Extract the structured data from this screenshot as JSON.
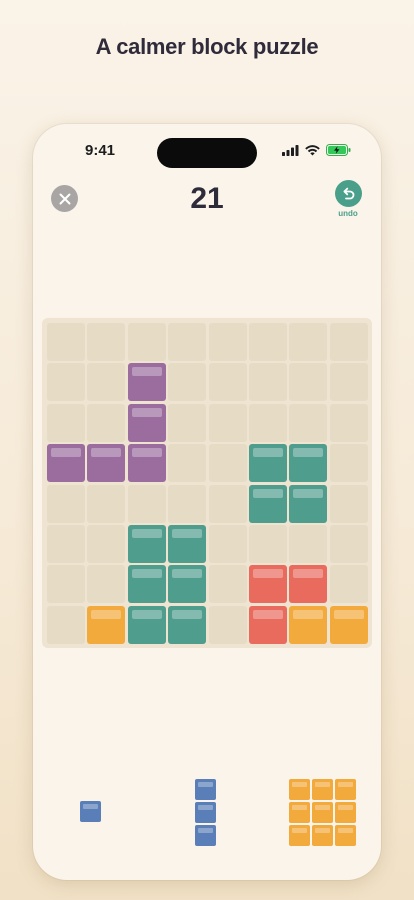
{
  "headline": "A calmer block puzzle",
  "status_bar": {
    "time": "9:41",
    "icons": [
      "signal-icon",
      "wifi-icon",
      "battery-charging-icon"
    ]
  },
  "game": {
    "score": "21",
    "close_icon": "close-icon",
    "undo_icon": "undo-icon",
    "undo_label": "undo"
  },
  "colors": {
    "purple": "#9a6d9e",
    "teal": "#4f9d8d",
    "orange": "#f2aa3c",
    "red": "#e96b5d",
    "blue": "#5a7fb8",
    "empty": "#e6dbc4"
  },
  "board": {
    "rows": 8,
    "cols": 8,
    "grid": [
      [
        ".",
        ".",
        ".",
        ".",
        ".",
        ".",
        ".",
        "."
      ],
      [
        ".",
        ".",
        "P",
        ".",
        ".",
        ".",
        ".",
        "."
      ],
      [
        ".",
        ".",
        "P",
        ".",
        ".",
        ".",
        ".",
        "."
      ],
      [
        "P",
        "P",
        "P",
        ".",
        ".",
        "T",
        "T",
        "."
      ],
      [
        ".",
        ".",
        ".",
        ".",
        ".",
        "T",
        "T",
        "."
      ],
      [
        ".",
        ".",
        "T",
        "T",
        ".",
        ".",
        ".",
        "."
      ],
      [
        ".",
        ".",
        "T",
        "T",
        ".",
        "R",
        "R",
        "."
      ],
      [
        ".",
        "O",
        "T",
        "T",
        ".",
        "R",
        "O",
        "O"
      ]
    ]
  },
  "tray": [
    {
      "name": "single-blue-piece",
      "color": "blue",
      "shape": [
        [
          1
        ]
      ]
    },
    {
      "name": "vertical-blue-piece",
      "color": "blue",
      "shape": [
        [
          1
        ],
        [
          1
        ],
        [
          1
        ]
      ]
    },
    {
      "name": "square-orange-piece",
      "color": "orange",
      "shape": [
        [
          1,
          1,
          1
        ],
        [
          1,
          1,
          1
        ],
        [
          1,
          1,
          1
        ]
      ]
    }
  ]
}
